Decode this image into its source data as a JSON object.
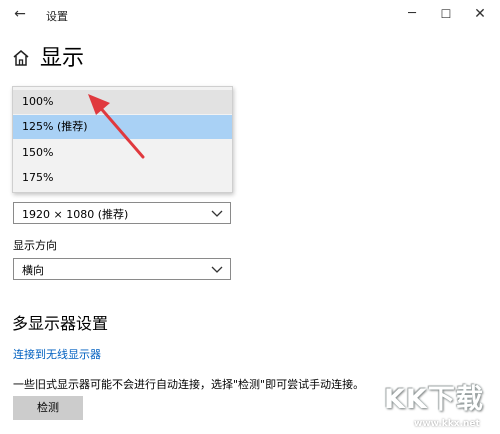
{
  "titlebar": {
    "title": "设置",
    "back_icon": "arrow-left-icon",
    "minimize": "─",
    "maximize": "☐",
    "close": "✕"
  },
  "header": {
    "home_icon": "home-icon",
    "title": "显示"
  },
  "scale_dropdown": {
    "options": [
      "100%",
      "125% (推荐)",
      "150%",
      "175%"
    ],
    "selected": "125% (推荐)",
    "hovered": "100%",
    "selected_color": "#a9d1f5"
  },
  "resolution": {
    "value": "1920 × 1080 (推荐)"
  },
  "orientation": {
    "label": "显示方向",
    "value": "横向"
  },
  "multi_display": {
    "title": "多显示器设置",
    "wireless_link": "连接到无线显示器",
    "note": "一些旧式显示器可能不会进行自动连接，选择\"检测\"即可尝试手动连接。",
    "detect_button": "检测"
  },
  "annotation": {
    "arrow_color": "#e0393e"
  },
  "watermark": {
    "brand": "KK下载",
    "url": "www.kkx.net"
  },
  "colors": {
    "link": "#0060c0",
    "button_bg": "#cccccc"
  }
}
